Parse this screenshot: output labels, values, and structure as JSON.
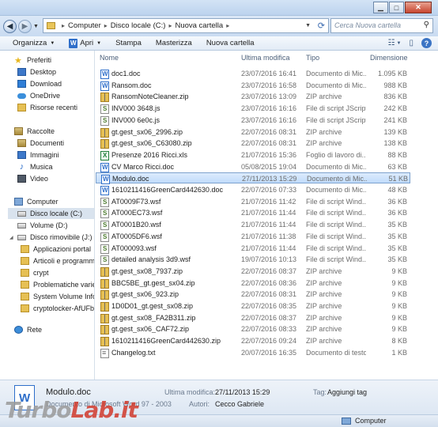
{
  "address": {
    "segments": [
      "Computer",
      "Disco locale (C:)",
      "Nuova cartella"
    ]
  },
  "search": {
    "placeholder": "Cerca Nuova cartella"
  },
  "toolbar": {
    "organize": "Organizza",
    "open": "Apri",
    "print": "Stampa",
    "burn": "Masterizza",
    "new_folder": "Nuova cartella"
  },
  "columns": {
    "name": "Nome",
    "modified": "Ultima modifica",
    "type": "Tipo",
    "size": "Dimensione"
  },
  "nav": {
    "favorites": "Preferiti",
    "desktop": "Desktop",
    "download": "Download",
    "onedrive": "OneDrive",
    "recent": "Risorse recenti",
    "libraries": "Raccolte",
    "documents": "Documenti",
    "images": "Immagini",
    "music": "Musica",
    "video": "Video",
    "computer": "Computer",
    "disk_c": "Disco locale (C:)",
    "disk_d": "Volume (D:)",
    "removable": "Disco rimovibile (J:)",
    "portable_apps": "Applicazioni portal",
    "articles": "Articoli e programm",
    "crypt": "crypt",
    "problems": "Problematiche varie",
    "sysvol": "System Volume Info",
    "cryptolocker": "cryptolocker-AfUFb",
    "network": "Rete"
  },
  "files": [
    {
      "name": "doc1.doc",
      "date": "23/07/2016 16:41",
      "type": "Documento di Mic...",
      "size": "1.095 KB",
      "icon": "doc"
    },
    {
      "name": "Ransom.doc",
      "date": "23/07/2016 16:58",
      "type": "Documento di Mic...",
      "size": "988 KB",
      "icon": "doc"
    },
    {
      "name": "RansomNoteCleaner.zip",
      "date": "23/07/2016 13:09",
      "type": "ZIP archive",
      "size": "836 KB",
      "icon": "zip"
    },
    {
      "name": "INV000 3648.js",
      "date": "23/07/2016 16:16",
      "type": "File di script JScript",
      "size": "242 KB",
      "icon": "js"
    },
    {
      "name": "INV000 6e0c.js",
      "date": "23/07/2016 16:16",
      "type": "File di script JScript",
      "size": "241 KB",
      "icon": "js"
    },
    {
      "name": "gt.gest_sx06_2996.zip",
      "date": "22/07/2016 08:31",
      "type": "ZIP archive",
      "size": "139 KB",
      "icon": "zip"
    },
    {
      "name": "gt.gest_sx06_C63080.zip",
      "date": "22/07/2016 08:31",
      "type": "ZIP archive",
      "size": "138 KB",
      "icon": "zip"
    },
    {
      "name": "Presenze 2016 Ricci.xls",
      "date": "21/07/2016 15:36",
      "type": "Foglio di lavoro di...",
      "size": "88 KB",
      "icon": "xls"
    },
    {
      "name": "CV Marco Ricci.doc",
      "date": "05/08/2015 19:04",
      "type": "Documento di Mic...",
      "size": "63 KB",
      "icon": "doc"
    },
    {
      "name": "Modulo.doc",
      "date": "27/11/2013 15:29",
      "type": "Documento di Mic...",
      "size": "51 KB",
      "icon": "doc"
    },
    {
      "name": "1610211416GreenCard442630.doc",
      "date": "22/07/2016 07:33",
      "type": "Documento di Mic...",
      "size": "48 KB",
      "icon": "doc"
    },
    {
      "name": "AT0009F73.wsf",
      "date": "21/07/2016 11:42",
      "type": "File di script Wind...",
      "size": "36 KB",
      "icon": "wsf"
    },
    {
      "name": "AT000EC73.wsf",
      "date": "21/07/2016 11:44",
      "type": "File di script Wind...",
      "size": "36 KB",
      "icon": "wsf"
    },
    {
      "name": "AT0001B20.wsf",
      "date": "21/07/2016 11:44",
      "type": "File di script Wind...",
      "size": "35 KB",
      "icon": "wsf"
    },
    {
      "name": "AT0005DF6.wsf",
      "date": "21/07/2016 11:38",
      "type": "File di script Wind...",
      "size": "35 KB",
      "icon": "wsf"
    },
    {
      "name": "AT000093.wsf",
      "date": "21/07/2016 11:44",
      "type": "File di script Wind...",
      "size": "35 KB",
      "icon": "wsf"
    },
    {
      "name": "detailed analysis 3d9.wsf",
      "date": "19/07/2016 10:13",
      "type": "File di script Wind...",
      "size": "35 KB",
      "icon": "wsf"
    },
    {
      "name": "gt.gest_sx08_7937.zip",
      "date": "22/07/2016 08:37",
      "type": "ZIP archive",
      "size": "9 KB",
      "icon": "zip"
    },
    {
      "name": "BBC5BE_gt.gest_sx04.zip",
      "date": "22/07/2016 08:36",
      "type": "ZIP archive",
      "size": "9 KB",
      "icon": "zip"
    },
    {
      "name": "gt.gest_sx06_923.zip",
      "date": "22/07/2016 08:31",
      "type": "ZIP archive",
      "size": "9 KB",
      "icon": "zip"
    },
    {
      "name": "1D0D01_gt.gest_sx08.zip",
      "date": "22/07/2016 08:35",
      "type": "ZIP archive",
      "size": "9 KB",
      "icon": "zip"
    },
    {
      "name": "gt.gest_sx08_FA2B311.zip",
      "date": "22/07/2016 08:37",
      "type": "ZIP archive",
      "size": "9 KB",
      "icon": "zip"
    },
    {
      "name": "gt.gest_sx06_CAF72.zip",
      "date": "22/07/2016 08:33",
      "type": "ZIP archive",
      "size": "9 KB",
      "icon": "zip"
    },
    {
      "name": "1610211416GreenCard442630.zip",
      "date": "22/07/2016 09:24",
      "type": "ZIP archive",
      "size": "8 KB",
      "icon": "zip"
    },
    {
      "name": "Changelog.txt",
      "date": "20/07/2016 16:35",
      "type": "Documento di testo",
      "size": "1 KB",
      "icon": "txt"
    }
  ],
  "selected_index": 9,
  "details": {
    "name": "Modulo.doc",
    "type": "Documento di Microsoft Word 97 - 2003",
    "modified_label": "Ultima modifica:",
    "modified_value": "27/11/2013 15:29",
    "authors_label": "Autori:",
    "authors_value": "Cecco Gabriele",
    "tags_label": "Tag:",
    "tags_value": "Aggiungi tag"
  },
  "status": {
    "location": "Computer"
  },
  "watermark": {
    "part1": "Turbo",
    "part2": "Lab.it"
  }
}
